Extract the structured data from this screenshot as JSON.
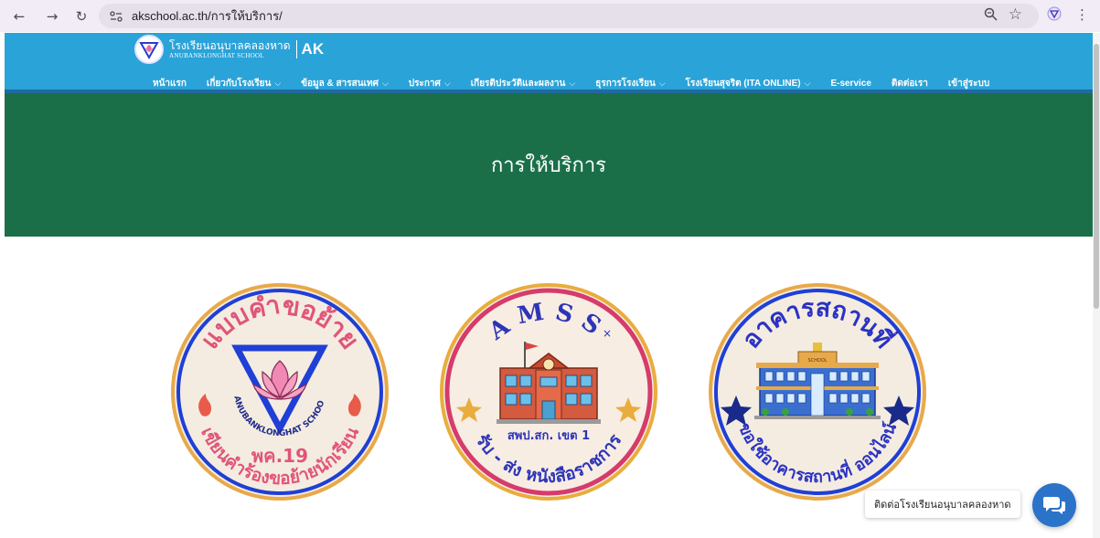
{
  "browser": {
    "url": "akschool.ac.th/การให้บริการ/",
    "back_icon": "arrow-left-icon",
    "forward_icon": "arrow-right-icon",
    "reload_icon": "reload-icon"
  },
  "header": {
    "school_name_th": "โรงเรียนอนุบาลคลองหาด",
    "school_name_en": "ANUBANKLONGHAT SCHOOL",
    "short_name": "AK",
    "menu": [
      {
        "label": "หน้าแรก",
        "has_dropdown": false
      },
      {
        "label": "เกี่ยวกับโรงเรียน",
        "has_dropdown": true
      },
      {
        "label": "ข้อมูล & สารสนเทศ",
        "has_dropdown": true
      },
      {
        "label": "ประกาศ",
        "has_dropdown": true
      },
      {
        "label": "เกียรติประวัติและผลงาน",
        "has_dropdown": true
      },
      {
        "label": "ธุรการโรงเรียน",
        "has_dropdown": true
      },
      {
        "label": "โรงเรียนสุจริต (ITA ONLINE)",
        "has_dropdown": true
      },
      {
        "label": "E-service",
        "has_dropdown": false
      },
      {
        "label": "ติดต่อเรา",
        "has_dropdown": false
      },
      {
        "label": "เข้าสู่ระบบ",
        "has_dropdown": false
      }
    ]
  },
  "hero": {
    "title": "การให้บริการ"
  },
  "services": [
    {
      "top_text": "แบบคำขอย้าย",
      "bottom_text": "เขียนคำร้องขอย้ายนักเรียน",
      "center_text": "พค.19",
      "arc_text": "ANUBANKLONGHAT SCHOOL",
      "ring_color": "#e8a94a",
      "inner_ring": "#1f3fd6",
      "text_color": "#e0557a"
    },
    {
      "top_text": "AMSS",
      "bottom_text": "รับ - ส่ง หนังสือราชการ",
      "center_text": "สพป.สก. เขต 1",
      "ring_color": "#e8ad3d",
      "inner_ring": "#d63b6b",
      "text_color": "#2d34b8"
    },
    {
      "top_text": "อาคารสถานที่",
      "bottom_text": "ขอใช้อาคารสถานที่ ออนไลน์",
      "building_label": "SCHOOL",
      "ring_color": "#e8a94a",
      "inner_ring": "#1f3fd6",
      "text_color": "#2b32c4"
    }
  ],
  "chat": {
    "label": "ติดต่อโรงเรียนอนุบาลคลองหาด",
    "icon": "chat-bubbles-icon"
  },
  "colors": {
    "header_bg": "#2aa3d9",
    "hero_bg": "#1a6f49",
    "chat_bg": "#2b73c8"
  }
}
